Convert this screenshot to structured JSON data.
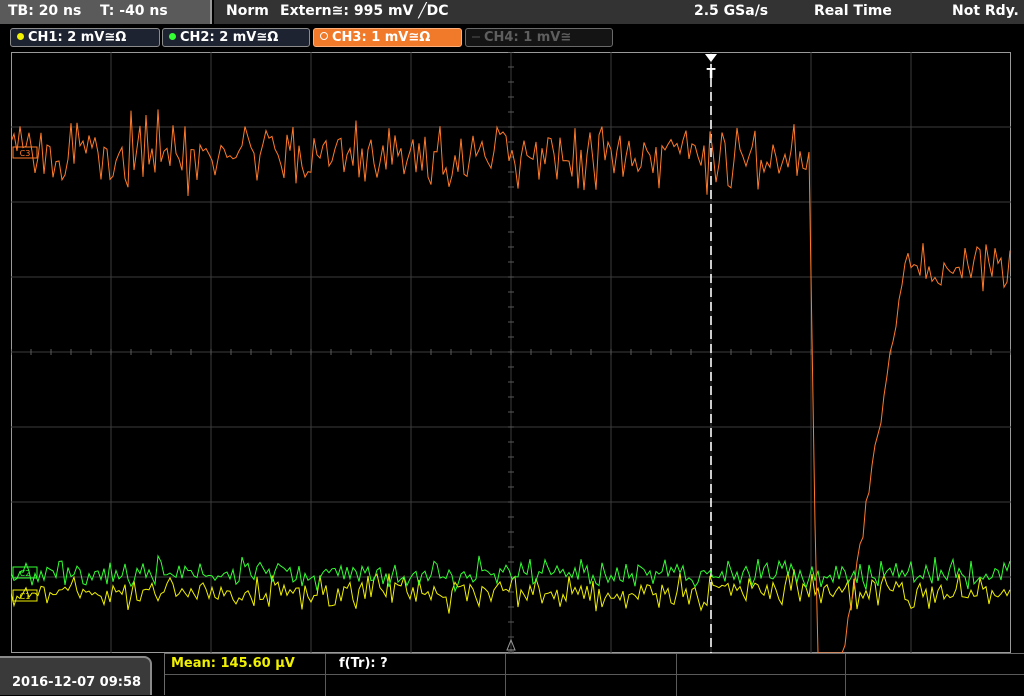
{
  "header": {
    "timebase": "TB: 20 ns",
    "trigger_time": "T: -40 ns",
    "trigger_mode": "Norm",
    "trigger_source": "Extern≅: 995 mV ╱DC",
    "sample_rate": "2.5 GSa/s",
    "acq_mode": "Real Time",
    "status": "Not Rdy."
  },
  "channels": [
    {
      "label": "CH1: 2 mV≅Ω",
      "color": "#f0f000",
      "active": true
    },
    {
      "label": "CH2: 2 mV≅Ω",
      "color": "#33ff33",
      "active": true
    },
    {
      "label": "CH3: 1 mV≅Ω",
      "color": "#ff7a2a",
      "active": true,
      "selected": true
    },
    {
      "label": "CH4: 1 mV≅",
      "color": "#5a5a5a",
      "active": false
    }
  ],
  "markers": {
    "ch3": "C3",
    "ch2": "C2",
    "ch1": "C1",
    "trigger": "T"
  },
  "footer": {
    "datetime": "2016-12-07 09:58",
    "mean_label": "Mean: 145.60 µV",
    "ftr_label": "f(Tr): ?"
  },
  "colors": {
    "ch1": "#f0f000",
    "ch2": "#33ff33",
    "ch3": "#ff7a2a",
    "grid": "#5a5a5a",
    "trigger": "#ffffff"
  }
}
